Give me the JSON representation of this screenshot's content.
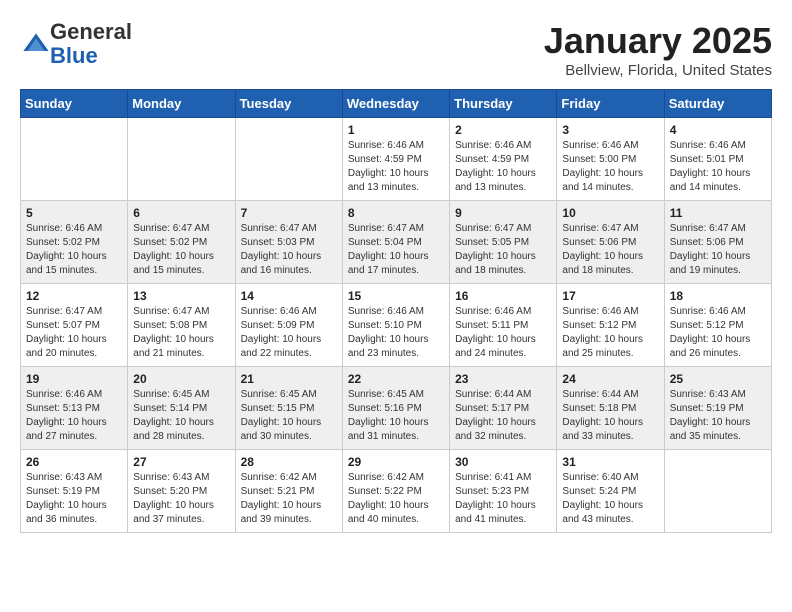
{
  "header": {
    "logo_general": "General",
    "logo_blue": "Blue",
    "month": "January 2025",
    "location": "Bellview, Florida, United States"
  },
  "weekdays": [
    "Sunday",
    "Monday",
    "Tuesday",
    "Wednesday",
    "Thursday",
    "Friday",
    "Saturday"
  ],
  "weeks": [
    [
      {
        "day": "",
        "info": ""
      },
      {
        "day": "",
        "info": ""
      },
      {
        "day": "",
        "info": ""
      },
      {
        "day": "1",
        "info": "Sunrise: 6:46 AM\nSunset: 4:59 PM\nDaylight: 10 hours\nand 13 minutes."
      },
      {
        "day": "2",
        "info": "Sunrise: 6:46 AM\nSunset: 4:59 PM\nDaylight: 10 hours\nand 13 minutes."
      },
      {
        "day": "3",
        "info": "Sunrise: 6:46 AM\nSunset: 5:00 PM\nDaylight: 10 hours\nand 14 minutes."
      },
      {
        "day": "4",
        "info": "Sunrise: 6:46 AM\nSunset: 5:01 PM\nDaylight: 10 hours\nand 14 minutes."
      }
    ],
    [
      {
        "day": "5",
        "info": "Sunrise: 6:46 AM\nSunset: 5:02 PM\nDaylight: 10 hours\nand 15 minutes."
      },
      {
        "day": "6",
        "info": "Sunrise: 6:47 AM\nSunset: 5:02 PM\nDaylight: 10 hours\nand 15 minutes."
      },
      {
        "day": "7",
        "info": "Sunrise: 6:47 AM\nSunset: 5:03 PM\nDaylight: 10 hours\nand 16 minutes."
      },
      {
        "day": "8",
        "info": "Sunrise: 6:47 AM\nSunset: 5:04 PM\nDaylight: 10 hours\nand 17 minutes."
      },
      {
        "day": "9",
        "info": "Sunrise: 6:47 AM\nSunset: 5:05 PM\nDaylight: 10 hours\nand 18 minutes."
      },
      {
        "day": "10",
        "info": "Sunrise: 6:47 AM\nSunset: 5:06 PM\nDaylight: 10 hours\nand 18 minutes."
      },
      {
        "day": "11",
        "info": "Sunrise: 6:47 AM\nSunset: 5:06 PM\nDaylight: 10 hours\nand 19 minutes."
      }
    ],
    [
      {
        "day": "12",
        "info": "Sunrise: 6:47 AM\nSunset: 5:07 PM\nDaylight: 10 hours\nand 20 minutes."
      },
      {
        "day": "13",
        "info": "Sunrise: 6:47 AM\nSunset: 5:08 PM\nDaylight: 10 hours\nand 21 minutes."
      },
      {
        "day": "14",
        "info": "Sunrise: 6:46 AM\nSunset: 5:09 PM\nDaylight: 10 hours\nand 22 minutes."
      },
      {
        "day": "15",
        "info": "Sunrise: 6:46 AM\nSunset: 5:10 PM\nDaylight: 10 hours\nand 23 minutes."
      },
      {
        "day": "16",
        "info": "Sunrise: 6:46 AM\nSunset: 5:11 PM\nDaylight: 10 hours\nand 24 minutes."
      },
      {
        "day": "17",
        "info": "Sunrise: 6:46 AM\nSunset: 5:12 PM\nDaylight: 10 hours\nand 25 minutes."
      },
      {
        "day": "18",
        "info": "Sunrise: 6:46 AM\nSunset: 5:12 PM\nDaylight: 10 hours\nand 26 minutes."
      }
    ],
    [
      {
        "day": "19",
        "info": "Sunrise: 6:46 AM\nSunset: 5:13 PM\nDaylight: 10 hours\nand 27 minutes."
      },
      {
        "day": "20",
        "info": "Sunrise: 6:45 AM\nSunset: 5:14 PM\nDaylight: 10 hours\nand 28 minutes."
      },
      {
        "day": "21",
        "info": "Sunrise: 6:45 AM\nSunset: 5:15 PM\nDaylight: 10 hours\nand 30 minutes."
      },
      {
        "day": "22",
        "info": "Sunrise: 6:45 AM\nSunset: 5:16 PM\nDaylight: 10 hours\nand 31 minutes."
      },
      {
        "day": "23",
        "info": "Sunrise: 6:44 AM\nSunset: 5:17 PM\nDaylight: 10 hours\nand 32 minutes."
      },
      {
        "day": "24",
        "info": "Sunrise: 6:44 AM\nSunset: 5:18 PM\nDaylight: 10 hours\nand 33 minutes."
      },
      {
        "day": "25",
        "info": "Sunrise: 6:43 AM\nSunset: 5:19 PM\nDaylight: 10 hours\nand 35 minutes."
      }
    ],
    [
      {
        "day": "26",
        "info": "Sunrise: 6:43 AM\nSunset: 5:19 PM\nDaylight: 10 hours\nand 36 minutes."
      },
      {
        "day": "27",
        "info": "Sunrise: 6:43 AM\nSunset: 5:20 PM\nDaylight: 10 hours\nand 37 minutes."
      },
      {
        "day": "28",
        "info": "Sunrise: 6:42 AM\nSunset: 5:21 PM\nDaylight: 10 hours\nand 39 minutes."
      },
      {
        "day": "29",
        "info": "Sunrise: 6:42 AM\nSunset: 5:22 PM\nDaylight: 10 hours\nand 40 minutes."
      },
      {
        "day": "30",
        "info": "Sunrise: 6:41 AM\nSunset: 5:23 PM\nDaylight: 10 hours\nand 41 minutes."
      },
      {
        "day": "31",
        "info": "Sunrise: 6:40 AM\nSunset: 5:24 PM\nDaylight: 10 hours\nand 43 minutes."
      },
      {
        "day": "",
        "info": ""
      }
    ]
  ]
}
